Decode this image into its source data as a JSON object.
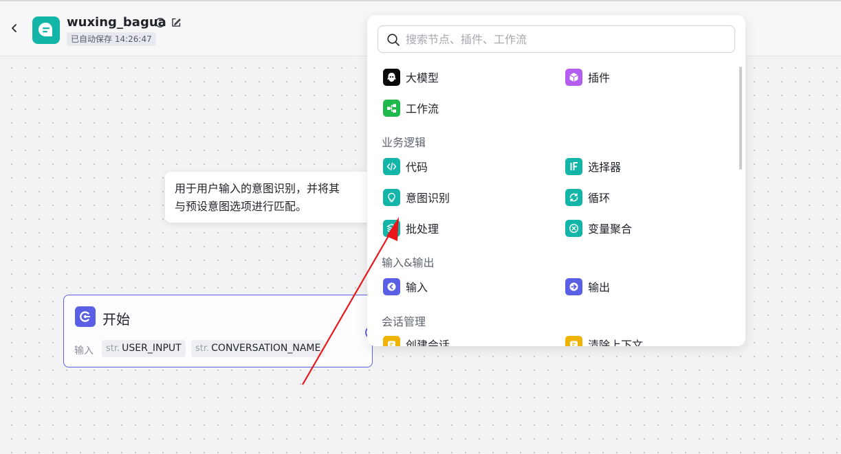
{
  "header": {
    "title": "wuxing_bagua",
    "save_status": "已自动保存 14:26:47"
  },
  "search": {
    "placeholder": "搜索节点、插件、工作流"
  },
  "panel": {
    "top_items": [
      {
        "label": "大模型",
        "icon": "llm-icon",
        "color": "#0a0a0a"
      },
      {
        "label": "插件",
        "icon": "plugin-icon",
        "color": "#b35ef0"
      },
      {
        "label": "工作流",
        "icon": "workflow-icon",
        "color": "#1fb84a"
      }
    ],
    "sections": [
      {
        "title": "业务逻辑",
        "items": [
          {
            "label": "代码",
            "icon": "code-icon",
            "color": "#13b5a8"
          },
          {
            "label": "选择器",
            "icon": "if-icon",
            "color": "#13b5a8"
          },
          {
            "label": "意图识别",
            "icon": "intent-icon",
            "color": "#13b5a8"
          },
          {
            "label": "循环",
            "icon": "loop-icon",
            "color": "#13b5a8"
          },
          {
            "label": "批处理",
            "icon": "batch-icon",
            "color": "#13b5a8"
          },
          {
            "label": "变量聚合",
            "icon": "variable-merge-icon",
            "color": "#13b5a8"
          }
        ]
      },
      {
        "title": "输入&输出",
        "items": [
          {
            "label": "输入",
            "icon": "input-icon",
            "color": "#5b5fe6"
          },
          {
            "label": "输出",
            "icon": "output-icon",
            "color": "#5b5fe6"
          }
        ]
      },
      {
        "title": "会话管理",
        "items": [
          {
            "label": "创建会话",
            "icon": "create-conversation-icon",
            "color": "#f0b400"
          },
          {
            "label": "清除上下文",
            "icon": "clear-context-icon",
            "color": "#f0b400"
          }
        ]
      }
    ]
  },
  "tooltip": {
    "text_line1": "用于用户输入的意图识别，并将其",
    "text_line2": "与预设意图选项进行匹配。"
  },
  "start_node": {
    "title": "开始",
    "inputs_label": "输入",
    "inputs": [
      {
        "type": "str.",
        "name": "USER_INPUT"
      },
      {
        "type": "str.",
        "name": "CONVERSATION_NAME"
      }
    ]
  },
  "annotation": {
    "arrow_color": "#e8161b"
  }
}
